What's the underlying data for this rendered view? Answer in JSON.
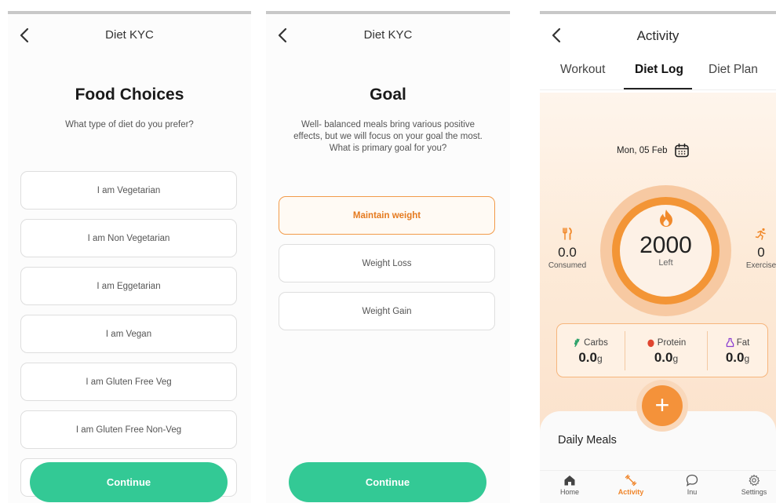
{
  "screen1": {
    "header_title": "Diet KYC",
    "heading": "Food Choices",
    "subtitle": "What type of diet do you prefer?",
    "options": [
      "I am Vegetarian",
      "I am Non Vegetarian",
      "I am Eggetarian",
      "I am Vegan",
      "I am Gluten Free Veg",
      "I am Gluten Free Non-Veg"
    ],
    "continue_label": "Continue"
  },
  "screen2": {
    "header_title": "Diet KYC",
    "heading": "Goal",
    "subtitle": "Well- balanced meals bring various positive effects, but we will focus on your goal the most. What is primary goal for you?",
    "options": [
      "Maintain weight",
      "Weight Loss",
      "Weight Gain"
    ],
    "selected_option": "Maintain weight",
    "continue_label": "Continue"
  },
  "screen3": {
    "header_title": "Activity",
    "tabs": [
      "Workout",
      "Diet Log",
      "Diet Plan"
    ],
    "active_tab": "Diet Log",
    "date": "Mon, 05 Feb",
    "calories_left": "2000",
    "calories_left_label": "Left",
    "consumed_value": "0.0",
    "consumed_label": "Consumed",
    "exercise_value": "0",
    "exercise_label": "Exercise",
    "macros": [
      {
        "name": "Carbs",
        "value": "0.0",
        "unit": "g",
        "icon": "wheat-icon"
      },
      {
        "name": "Protein",
        "value": "0.0",
        "unit": "g",
        "icon": "protein-drop-icon"
      },
      {
        "name": "Fat",
        "value": "0.0",
        "unit": "g",
        "icon": "fat-bottle-icon"
      }
    ],
    "add_label": "+",
    "daily_meals_title": "Daily Meals",
    "nav": [
      {
        "label": "Home",
        "icon": "home-icon"
      },
      {
        "label": "Activity",
        "icon": "dumbbell-icon"
      },
      {
        "label": "Inu",
        "icon": "chat-icon"
      },
      {
        "label": "Settings",
        "icon": "gear-icon"
      }
    ],
    "active_nav": "Activity"
  },
  "colors": {
    "primary_green": "#33c995",
    "accent_orange": "#f4923a",
    "selected_border": "#f29b4a"
  }
}
